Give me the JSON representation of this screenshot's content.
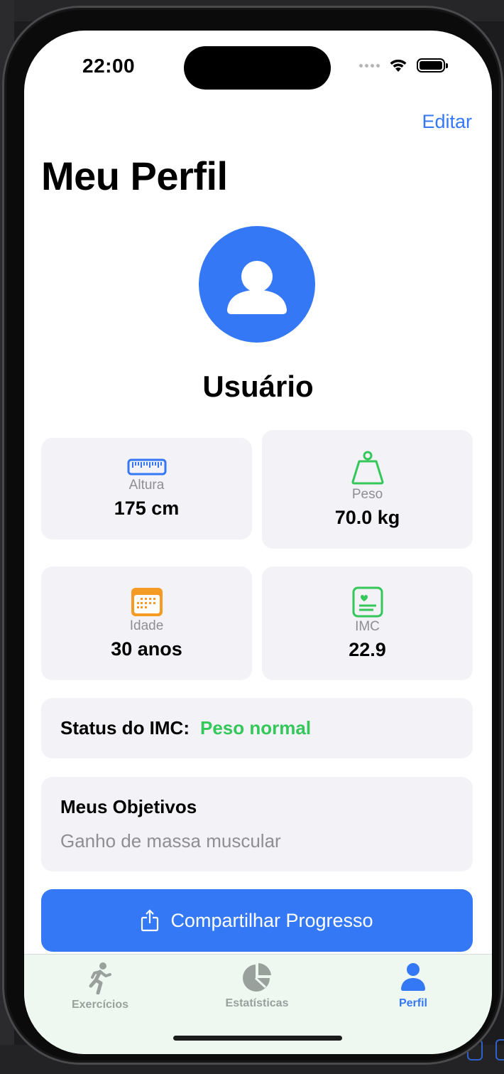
{
  "status_bar": {
    "time": "22:00"
  },
  "header": {
    "edit_label": "Editar",
    "title": "Meu Perfil"
  },
  "profile": {
    "name": "Usuário",
    "avatar_icon": "person-circle-icon",
    "avatar_color": "#3478f6"
  },
  "stats": {
    "height": {
      "label": "Altura",
      "value": "175 cm",
      "icon": "ruler-icon",
      "color": "#3478f6"
    },
    "weight": {
      "label": "Peso",
      "value": "70.0 kg",
      "icon": "scale-weight-icon",
      "color": "#34c759"
    },
    "age": {
      "label": "Idade",
      "value": "30 anos",
      "icon": "calendar-icon",
      "color": "#f59a23"
    },
    "bmi": {
      "label": "IMC",
      "value": "22.9",
      "icon": "health-card-icon",
      "color": "#34c759"
    }
  },
  "bmi_status": {
    "label": "Status do IMC:",
    "value": "Peso normal",
    "value_color": "#34c759"
  },
  "goals": {
    "title": "Meus Objetivos",
    "text": "Ganho de massa muscular"
  },
  "share_button": {
    "label": "Compartilhar Progresso",
    "icon": "share-icon"
  },
  "tabbar": {
    "items": [
      {
        "label": "Exercícios",
        "icon": "running-figure-icon",
        "active": false
      },
      {
        "label": "Estatísticas",
        "icon": "pie-chart-icon",
        "active": false
      },
      {
        "label": "Perfil",
        "icon": "person-icon",
        "active": true
      }
    ]
  }
}
